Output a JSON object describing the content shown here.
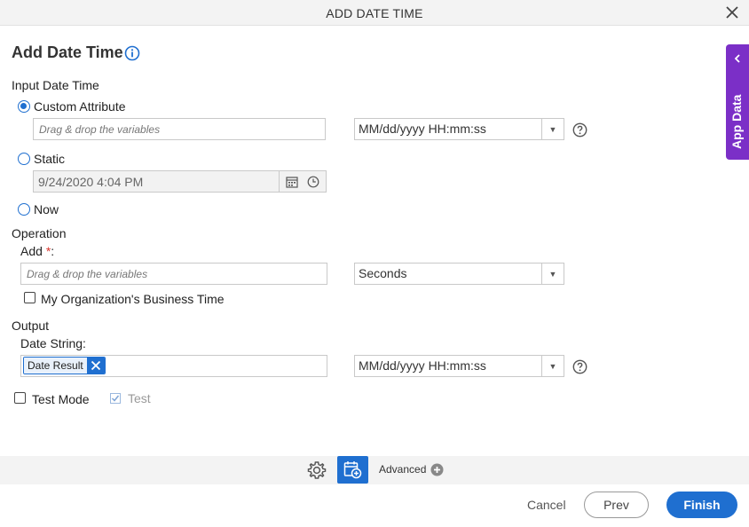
{
  "dialog": {
    "title": "ADD DATE TIME",
    "heading": "Add Date Time"
  },
  "input_date_time": {
    "section_label": "Input Date Time",
    "custom_attribute": {
      "label": "Custom Attribute",
      "selected": true,
      "placeholder": "Drag & drop the variables",
      "format": "MM/dd/yyyy HH:mm:ss"
    },
    "static": {
      "label": "Static",
      "selected": false,
      "value": "9/24/2020 4:04 PM"
    },
    "now": {
      "label": "Now",
      "selected": false
    }
  },
  "operation": {
    "section_label": "Operation",
    "add_label": "Add",
    "required_mark": "*",
    "colon": ":",
    "placeholder": "Drag & drop the variables",
    "unit": "Seconds",
    "business_time_label": "My Organization's Business Time",
    "business_time_checked": false
  },
  "output": {
    "section_label": "Output",
    "date_string_label": "Date String:",
    "chip": "Date Result",
    "format": "MM/dd/yyyy HH:mm:ss"
  },
  "test_mode": {
    "label": "Test Mode",
    "checked": false,
    "test_label": "Test"
  },
  "side_tab": {
    "label": "App Data"
  },
  "toolbar": {
    "advanced_label": "Advanced"
  },
  "footer": {
    "cancel": "Cancel",
    "prev": "Prev",
    "finish": "Finish"
  },
  "colors": {
    "accent": "#1f6fd0",
    "side_tab": "#7b2fc7",
    "required": "#d9342b"
  }
}
